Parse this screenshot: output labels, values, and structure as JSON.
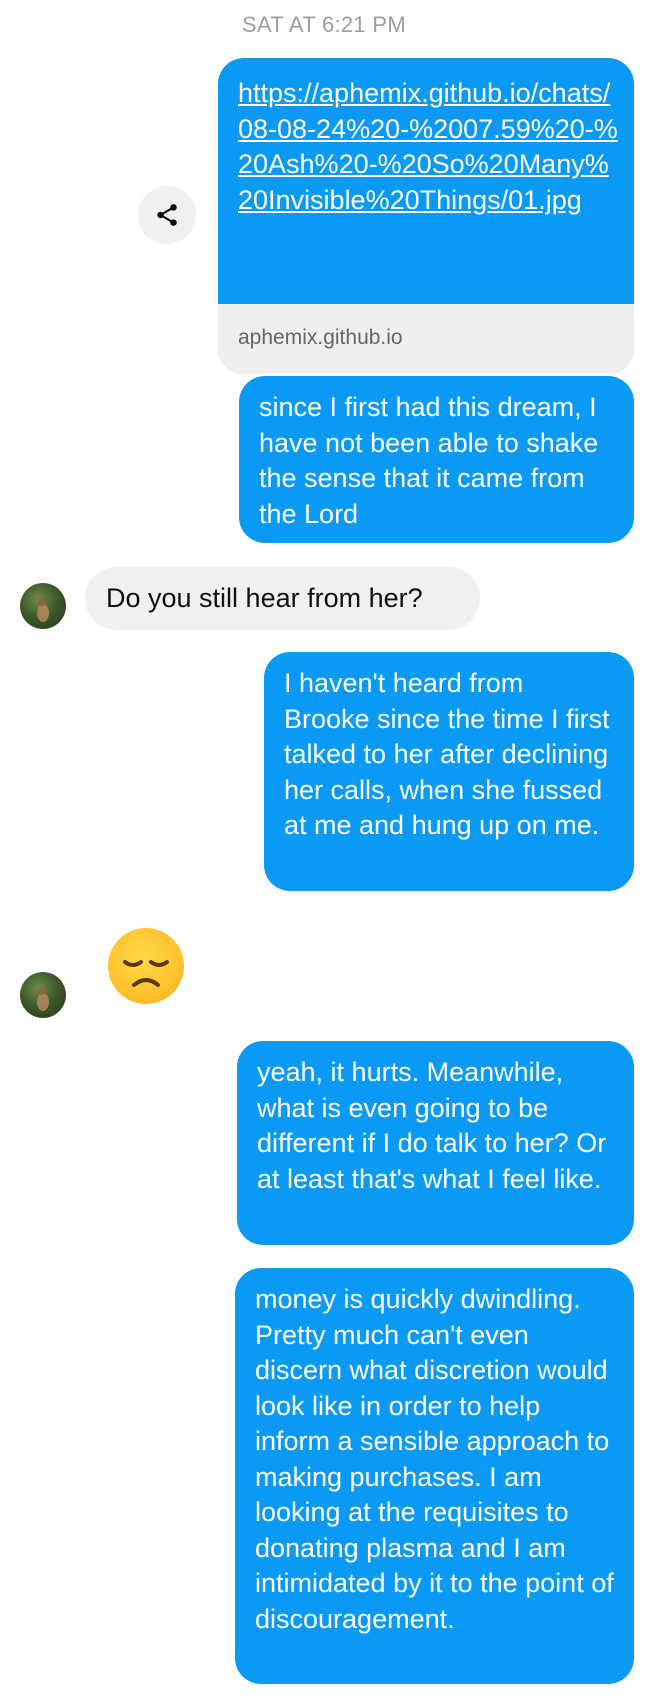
{
  "timestamp": "SAT AT 6:21 PM",
  "link_card": {
    "url": "https://aphemix.github.io/chats/08-08-24%20-%2007.59%20-%20Ash%20-%20So%20Many%20Invisible%20Things/01.jpg",
    "domain": "aphemix.github.io"
  },
  "messages": [
    {
      "id": "m1",
      "direction": "outgoing",
      "text": "since I first had this dream, I have not been able to shake the sense that it came from the Lord"
    },
    {
      "id": "m2",
      "direction": "incoming",
      "text": "Do you still hear from her?"
    },
    {
      "id": "m3",
      "direction": "outgoing",
      "text": "I haven't heard from Brooke since the time I first talked to her after declining her calls, when she fussed at me and hung up on me."
    },
    {
      "id": "m4",
      "direction": "incoming",
      "emoji": "disappointed-face"
    },
    {
      "id": "m5",
      "direction": "outgoing",
      "text": "yeah, it hurts. Meanwhile, what is even going to be different if I do talk to her? Or at least that's what I feel like."
    },
    {
      "id": "m6",
      "direction": "outgoing",
      "text": "money is quickly dwindling. Pretty much can't even discern what discretion would look like in order to help inform a sensible approach to making purchases. I am looking at the requisites to donating plasma and I am intimidated by it to the point of discouragement."
    }
  ],
  "colors": {
    "outgoing_bubble": "#0a9af5",
    "incoming_bubble": "#f0f0f0",
    "timestamp_text": "#9e9e9e"
  },
  "icons": {
    "share": "share-icon",
    "avatar": "contact-avatar"
  }
}
